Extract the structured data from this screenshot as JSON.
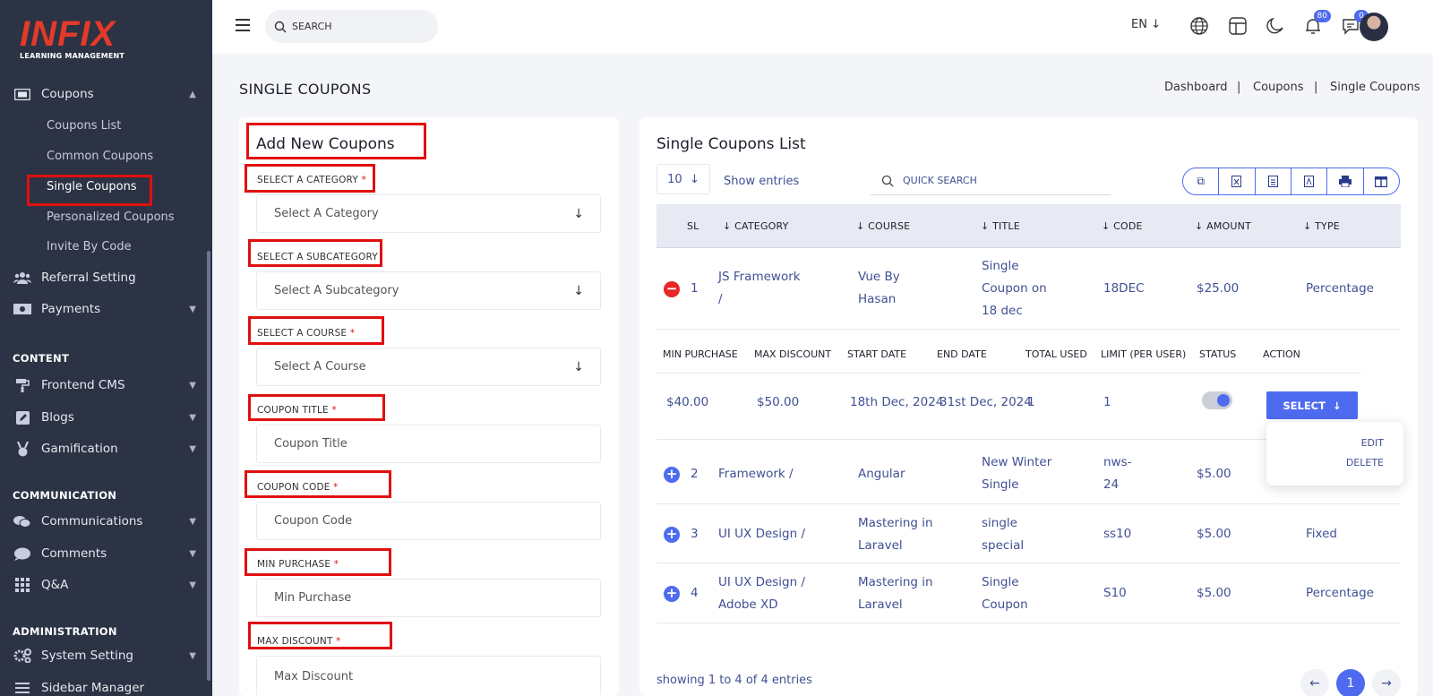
{
  "brand": {
    "logo": "INFIX",
    "tagline": "LEARNING MANAGEMENT"
  },
  "sidebar": {
    "coupons": "Coupons",
    "sub": [
      "Coupons List",
      "Common Coupons",
      "Single Coupons",
      "Personalized Coupons",
      "Invite By Code"
    ],
    "referral": "Referral Setting",
    "payments": "Payments",
    "content_head": "CONTENT",
    "frontend": "Frontend CMS",
    "blogs": "Blogs",
    "gamification": "Gamification",
    "communication_head": "COMMUNICATION",
    "communications": "Communications",
    "comments": "Comments",
    "qa": "Q&A",
    "admin_head": "ADMINISTRATION",
    "system": "System Setting",
    "sidebar_manager": "Sidebar Manager"
  },
  "topbar": {
    "search_placeholder": "SEARCH",
    "lang": "EN",
    "notif_count": "80",
    "msg_count": "0"
  },
  "page": {
    "title": "SINGLE COUPONS",
    "breadcrumb": [
      "Dashboard",
      "|",
      "Coupons",
      "|",
      "Single Coupons"
    ]
  },
  "form": {
    "title": "Add New Coupons",
    "fields": [
      {
        "label": "SELECT A CATEGORY",
        "req": "*",
        "placeholder": "Select A Category"
      },
      {
        "label": "SELECT A SUBCATEGORY",
        "req": "",
        "placeholder": "Select A Subcategory"
      },
      {
        "label": "SELECT A COURSE",
        "req": "*",
        "placeholder": "Select A Course"
      },
      {
        "label": "COUPON TITLE",
        "req": "*",
        "placeholder": "Coupon Title"
      },
      {
        "label": "COUPON CODE",
        "req": "*",
        "placeholder": "Coupon Code"
      },
      {
        "label": "MIN PURCHASE",
        "req": "*",
        "placeholder": "Min Purchase"
      },
      {
        "label": "MAX DISCOUNT",
        "req": "*",
        "placeholder": "Max Discount"
      }
    ]
  },
  "list": {
    "title": "Single Coupons List",
    "entries": "10",
    "show_entries": "Show entries",
    "quick_search": "QUICK SEARCH",
    "columns": [
      "SL",
      "CATEGORY",
      "COURSE",
      "TITLE",
      "CODE",
      "AMOUNT",
      "TYPE"
    ],
    "rows": [
      {
        "sl": "1",
        "category": [
          "JS Framework",
          "/"
        ],
        "course": [
          "Vue By",
          "Hasan"
        ],
        "title": [
          "Single",
          "Coupon on",
          "18 dec"
        ],
        "code": "18DEC",
        "amount": "$25.00",
        "type": "Percentage"
      },
      {
        "sl": "2",
        "category": [
          "Framework /"
        ],
        "course": [
          "Angular"
        ],
        "title": [
          "New Winter",
          "Single"
        ],
        "code": [
          "nws-",
          "24"
        ],
        "amount": "$5.00",
        "type": ""
      },
      {
        "sl": "3",
        "category": [
          "UI UX Design /"
        ],
        "course": [
          "Mastering in",
          "Laravel"
        ],
        "title": [
          "single",
          "special"
        ],
        "code": "ss10",
        "amount": "$5.00",
        "type": "Fixed"
      },
      {
        "sl": "4",
        "category": [
          "UI UX Design /",
          "Adobe XD"
        ],
        "course": [
          "Mastering in",
          "Laravel"
        ],
        "title": [
          "Single",
          "Coupon"
        ],
        "code": "S10",
        "amount": "$5.00",
        "type": "Percentage"
      }
    ],
    "sub_columns": [
      "MIN PURCHASE",
      "MAX DISCOUNT",
      "START DATE",
      "END DATE",
      "TOTAL USED",
      "LIMIT (PER USER)",
      "STATUS",
      "ACTION"
    ],
    "sub_row": {
      "min": "$40.00",
      "max": "$50.00",
      "start": "18th Dec, 2024",
      "end": "31st Dec, 2024",
      "used": "1",
      "limit": "1",
      "status_on": true
    },
    "select_label": "SELECT",
    "menu": [
      "EDIT",
      "DELETE"
    ],
    "showing": "showing 1 to 4 of 4 entries",
    "page": "1"
  },
  "colors": {
    "accent": "#4e6bef",
    "sidebar": "#2b3344",
    "highlight": "#e01010"
  }
}
